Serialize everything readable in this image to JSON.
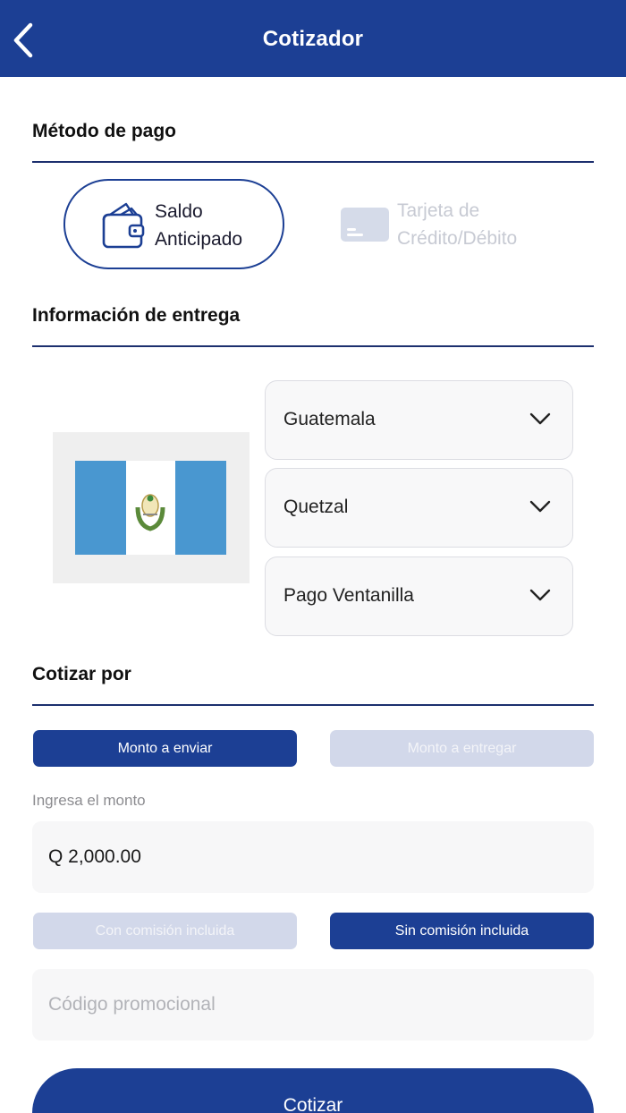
{
  "header": {
    "title": "Cotizador",
    "back_icon": "chevron-left-icon"
  },
  "payment": {
    "title": "Método de pago",
    "options": [
      {
        "label_line1": "Saldo",
        "label_line2": "Anticipado",
        "icon": "wallet-icon",
        "selected": true
      },
      {
        "label_line1": "Tarjeta de",
        "label_line2": "Crédito/Débito",
        "icon": "credit-card-icon",
        "selected": false
      }
    ]
  },
  "delivery": {
    "title": "Información de entrega",
    "flag": "guatemala-flag",
    "country": "Guatemala",
    "currency": "Quetzal",
    "method": "Pago Ventanilla"
  },
  "quote_by": {
    "title": "Cotizar por",
    "send_label": "Monto a enviar",
    "receive_label": "Monto a entregar",
    "active": "send"
  },
  "amount": {
    "hint": "Ingresa el monto",
    "value": "Q 2,000.00"
  },
  "commission": {
    "included_label": "Con comisión incluida",
    "excluded_label": "Sin comisión incluida",
    "active": "excluded"
  },
  "promo": {
    "placeholder": "Código promocional"
  },
  "cta": {
    "label": "Cotizar"
  },
  "colors": {
    "primary": "#1c3f94",
    "inactive": "#d2d8ea",
    "divider": "#1c2f6e",
    "flag_blue": "#4997d0"
  }
}
